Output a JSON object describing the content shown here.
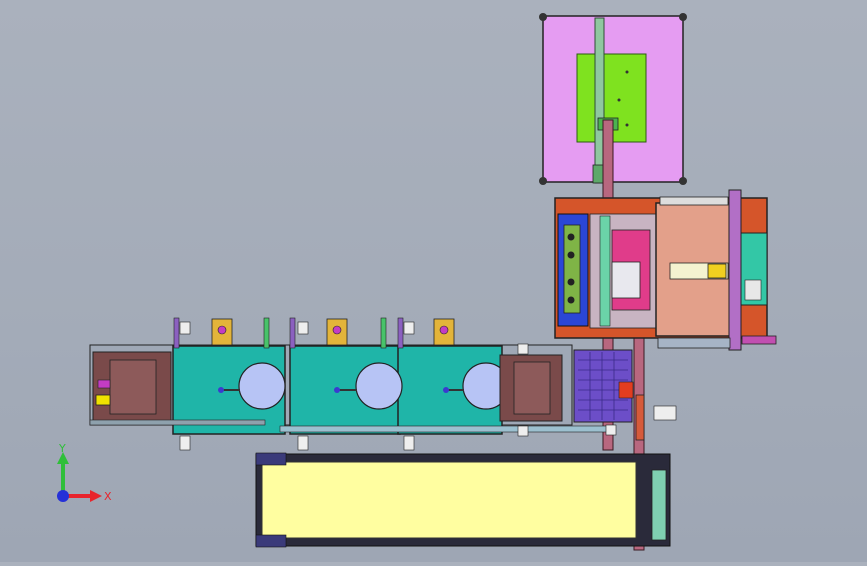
{
  "viewport": {
    "background_top": "#aab1bd",
    "background_bottom": "#9ea6b4"
  },
  "triad": {
    "x_label": "X",
    "y_label": "Y",
    "x_color": "#e8242c",
    "y_color": "#2fbf3a",
    "z_color": "#2530d8"
  },
  "colors": {
    "feed_table": "#e59cf2",
    "feed_plate": "#7fe21f",
    "orange_frame": "#d5552a",
    "salmon_panel": "#e3a08a",
    "blue_panel": "#2b46d6",
    "press_plate": "#1fb5a8",
    "platen_disc": "#b7c4f5",
    "conveyor_belt": "#fffea0",
    "dark_frame": "#2a2a3a"
  }
}
